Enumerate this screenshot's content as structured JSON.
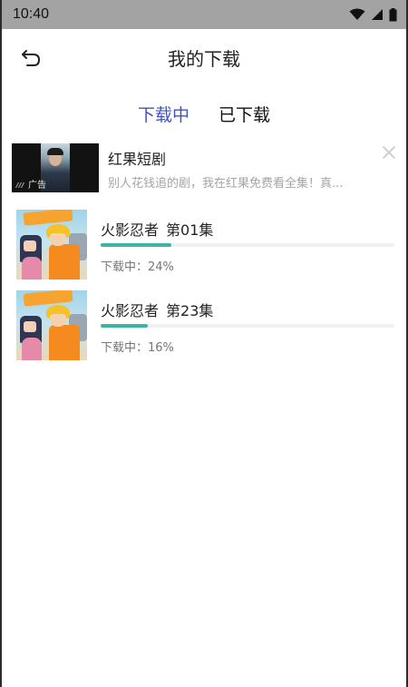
{
  "status_bar": {
    "time": "10:40",
    "icons": [
      "wifi-icon",
      "signal-icon",
      "battery-icon"
    ]
  },
  "header": {
    "title": "我的下载",
    "back_icon": "back-arrow-icon"
  },
  "tabs": [
    {
      "label": "下载中",
      "active": true
    },
    {
      "label": "已下载",
      "active": false
    }
  ],
  "ad": {
    "title": "红果短剧",
    "description": "别人花钱追的剧，我在红果免费看全集！真...",
    "tag": "广告",
    "close_icon": "close-icon"
  },
  "downloads": [
    {
      "title": "火影忍者",
      "episode": "第01集",
      "status_label": "下载中：",
      "percent_text": "24%",
      "progress": 0.24
    },
    {
      "title": "火影忍者",
      "episode": "第23集",
      "status_label": "下载中：",
      "percent_text": "16%",
      "progress": 0.16
    }
  ],
  "colors": {
    "accent": "#3f51c8",
    "progress": "#3db3a3",
    "status_bar": "#a3a3a3"
  }
}
